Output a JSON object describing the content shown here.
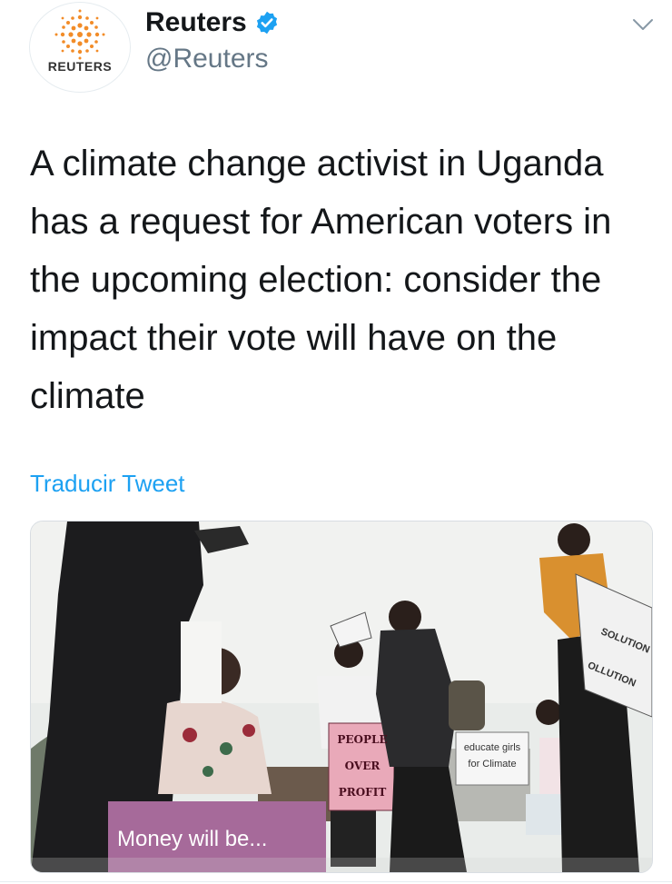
{
  "tweet": {
    "author": {
      "name": "Reuters",
      "handle": "@Reuters",
      "avatar_text": "REUTERS",
      "verified": true
    },
    "text": "A climate change activist in Uganda has a request for American voters in the upcoming election: consider the impact their vote will have on the climate",
    "translate_label": "Traducir Tweet",
    "media": {
      "signs": {
        "people_over_profit": [
          "PEOPLE",
          "OVER",
          "PROFIT"
        ],
        "educate": [
          "educate girls",
          "for Climate"
        ],
        "solution": [
          "SOLUTION",
          "OLLUTION"
        ],
        "money": "Money will be..."
      }
    }
  },
  "icons": {
    "verified": "verified-badge-icon",
    "menu": "chevron-down-icon"
  },
  "colors": {
    "link": "#1da1f2",
    "verified": "#1da1f2",
    "reuters_orange": "#f28c28"
  }
}
